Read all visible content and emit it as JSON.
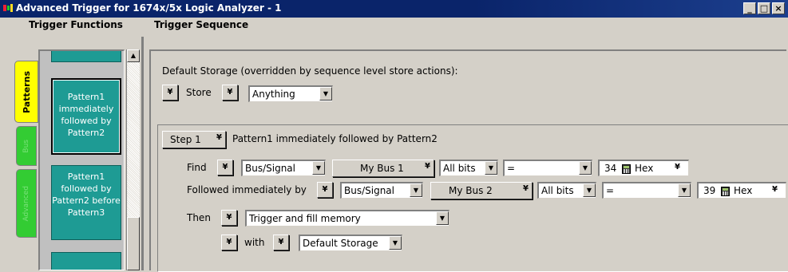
{
  "window": {
    "title": "Advanced Trigger for 1674x/5x Logic Analyzer - 1",
    "buttons": [
      "_",
      "□",
      "×"
    ]
  },
  "headers": {
    "left": "Trigger Functions",
    "right": "Trigger Sequence"
  },
  "tabs": [
    {
      "label": "Patterns",
      "color": "#ffff00",
      "active": true
    },
    {
      "label": "Bus",
      "color": "#33cc33"
    },
    {
      "label": "Advanced",
      "color": "#33cc33"
    }
  ],
  "palette": {
    "tiles": [
      {
        "label": "Pattern1 immediately followed by Pattern2",
        "selected": true
      },
      {
        "label": "Pattern1 followed by Pattern2 before Pattern3"
      }
    ]
  },
  "default_storage": {
    "caption": "Default Storage (overridden by sequence level store actions):",
    "store_label": "Store",
    "store_value": "Anything"
  },
  "step": {
    "step_label": "Step 1",
    "description": "Pattern1 immediately followed by Pattern2",
    "find": {
      "label": "Find",
      "type": "Bus/Signal",
      "bus": "My Bus 1",
      "bits": "All bits",
      "operator": "=",
      "value": "34",
      "base": "Hex"
    },
    "followed": {
      "label": "Followed immediately by",
      "type": "Bus/Signal",
      "bus": "My Bus 2",
      "bits": "All bits",
      "operator": "=",
      "value": "39",
      "base": "Hex"
    },
    "then": {
      "label": "Then",
      "action": "Trigger and fill memory"
    },
    "with": {
      "label": "with",
      "storage": "Default Storage"
    }
  },
  "icons": {
    "app": "logic-analyzer-icon",
    "chevron": "double-chevron-down-icon",
    "combo_arrow": "triangle-down-icon",
    "calc": "calculator-icon"
  },
  "colors": {
    "title_bar": "#0a246a",
    "tile": "#1e9b94",
    "face": "#d4d0c8"
  }
}
